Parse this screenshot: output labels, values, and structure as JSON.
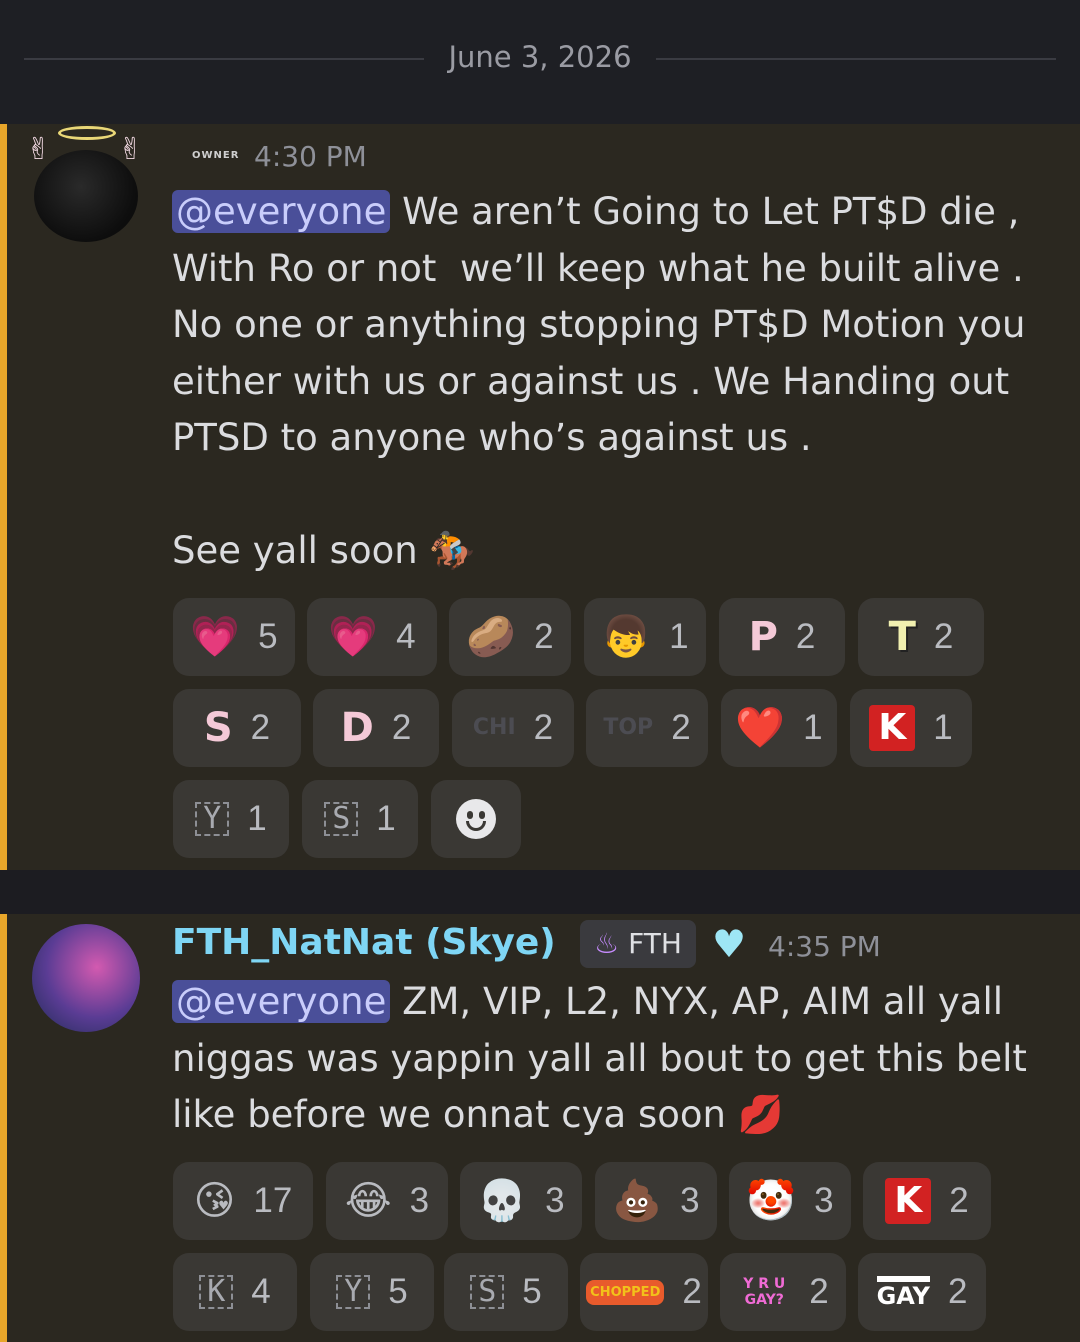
{
  "date_separator": "June 3, 2026",
  "message1": {
    "role_tag": "OWNER",
    "time": "4:30 PM",
    "mention": "@everyone",
    "text": " We aren’t Going to Let PT$D die ,\nWith Ro or not  we’ll keep what he built alive .\nNo one or anything stopping PT$D Motion you\neither with us or against us . We Handing out\nPTSD to anyone who’s against us .\n\nSee yall soon 🏇",
    "reactions": [
      {
        "emoji": "💗",
        "count": "5"
      },
      {
        "emoji": "💗",
        "count": "4"
      },
      {
        "emoji": "🥔",
        "count": "2"
      },
      {
        "emoji": "👦",
        "count": "1"
      },
      {
        "emoji": "P",
        "count": "2"
      },
      {
        "emoji": "T",
        "count": "2"
      },
      {
        "emoji": "S",
        "count": "2"
      },
      {
        "emoji": "D",
        "count": "2"
      },
      {
        "emoji": "CHI",
        "count": "2"
      },
      {
        "emoji": "TOP",
        "count": "2"
      },
      {
        "emoji": "❤️",
        "count": "1"
      },
      {
        "emoji": "K",
        "count": "1"
      },
      {
        "emoji": "Y",
        "count": "1"
      },
      {
        "emoji": "S",
        "count": "1"
      }
    ]
  },
  "message2": {
    "username": "FTH_NatNat (Skye)",
    "clan_tag": "FTH",
    "time": "4:35 PM",
    "mention": "@everyone",
    "text": " ZM, VIP, L2, NYX, AP, AIM all yall\nniggas was yappin yall all bout to get this belt\nlike before we onnat cya soon 💋",
    "reactions": [
      {
        "emoji": "😘",
        "count": "17"
      },
      {
        "emoji": "😂",
        "count": "3"
      },
      {
        "emoji": "💀",
        "count": "3"
      },
      {
        "emoji": "💩",
        "count": "3"
      },
      {
        "emoji": "🤡",
        "count": "3"
      },
      {
        "emoji": "K",
        "count": "2"
      },
      {
        "emoji": "K",
        "count": "4"
      },
      {
        "emoji": "Y",
        "count": "5"
      },
      {
        "emoji": "S",
        "count": "5"
      },
      {
        "emoji": "CHOPPED",
        "count": "2"
      },
      {
        "emoji": "Y R U GAY?",
        "count": "2"
      },
      {
        "emoji": "GAY",
        "count": "2"
      }
    ]
  },
  "colors": {
    "accent": "#e8a62a",
    "mention_bg": "#4a4f99",
    "username": "#7fd6f5"
  }
}
